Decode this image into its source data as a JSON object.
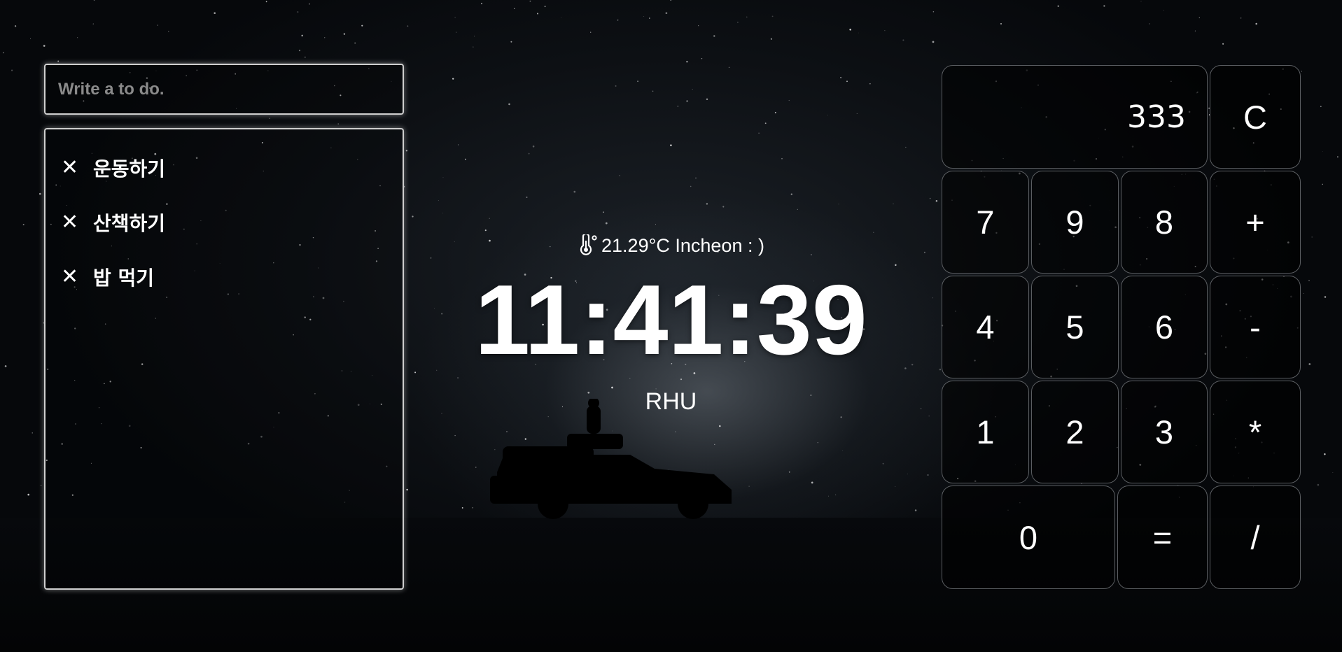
{
  "todo": {
    "placeholder": "Write a to do.",
    "delete_glyph": "✕",
    "items": [
      {
        "text": "운동하기"
      },
      {
        "text": "산책하기"
      },
      {
        "text": "밥 먹기"
      }
    ]
  },
  "weather": {
    "icon": "thermometer-icon",
    "text": "21.29°C Incheon : )"
  },
  "clock": {
    "time": "11:41:39"
  },
  "greeting": {
    "name": "RHU"
  },
  "calculator": {
    "display": "333",
    "keys": {
      "clear": "C",
      "seven": "7",
      "nine": "9",
      "eight": "8",
      "plus": "+",
      "four": "4",
      "five": "5",
      "six": "6",
      "minus": "-",
      "one": "1",
      "two": "2",
      "three": "3",
      "multiply": "*",
      "zero": "0",
      "equals": "=",
      "divide": "/"
    }
  }
}
